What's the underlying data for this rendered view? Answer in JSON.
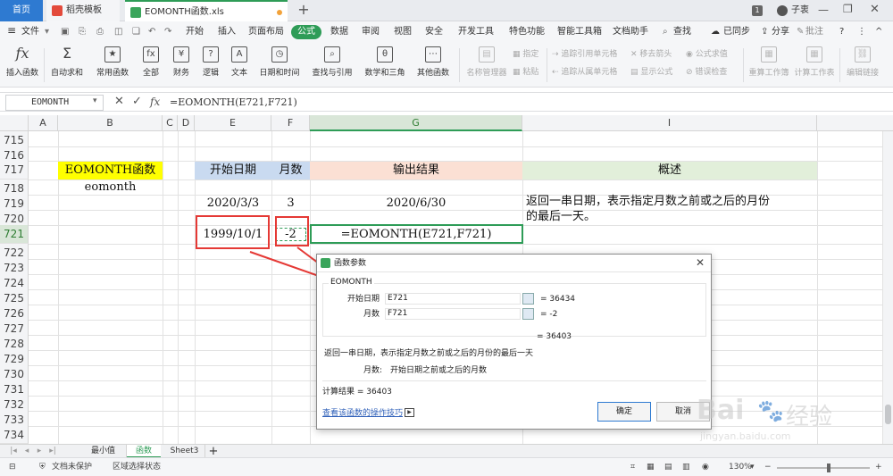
{
  "tabs": {
    "home": "首页",
    "templates": "稻壳模板",
    "file": "EOMONTH函数.xls",
    "add": "+"
  },
  "window": {
    "badge": "1",
    "user": "子衷"
  },
  "menu": {
    "file": "文件",
    "items": [
      "开始",
      "插入",
      "页面布局",
      "公式",
      "数据",
      "审阅",
      "视图",
      "安全",
      "开发工具",
      "特色功能",
      "智能工具箱",
      "文档助手"
    ],
    "search": "查找",
    "sync": "已同步",
    "share": "分享",
    "comment": "批注"
  },
  "ribbon": {
    "insert_function": "插入函数",
    "autosum": "自动求和",
    "common": "常用函数",
    "all": "全部",
    "finance": "财务",
    "logic": "逻辑",
    "text": "文本",
    "datetime": "日期和时间",
    "lookup": "查找与引用",
    "math": "数学和三角",
    "other": "其他函数",
    "name_manager": "名称管理器",
    "specify": "指定",
    "paste": "粘贴",
    "trace_precedents": "追踪引用单元格",
    "trace_dependents": "追踪从属单元格",
    "remove_arrows": "移去箭头",
    "show_formulas": "显示公式",
    "evaluate": "公式求值",
    "error_check": "错误检查",
    "recalc_workbook": "重算工作簿",
    "calc_sheet": "计算工作表",
    "edit_links": "编辑链接"
  },
  "formula_bar": {
    "name_box": "EOMONTH",
    "fx": "fx",
    "formula": "=EOMONTH(E721,F721)"
  },
  "columns": [
    "A",
    "B",
    "C",
    "D",
    "E",
    "F",
    "G",
    "I"
  ],
  "rows": [
    "715",
    "716",
    "717",
    "718",
    "719",
    "720",
    "721",
    "722",
    "723",
    "724",
    "725",
    "726",
    "727",
    "728",
    "729",
    "730",
    "731",
    "732",
    "733",
    "734"
  ],
  "cells": {
    "b717": "EOMONTH函数",
    "b718": "eomonth",
    "e717": "开始日期",
    "f717": "月数",
    "g717": "输出结果",
    "i717": "概述",
    "e719": "2020/3/3",
    "f719": "3",
    "g719": "2020/6/30",
    "i719a": "返回一串日期，表示指定月数之前或之后的月份",
    "i719b": "的最后一天。",
    "e721": "1999/10/1",
    "f721": "-2",
    "g721": "=EOMONTH(E721,F721)"
  },
  "dialog": {
    "title": "函数参数",
    "func": "EOMONTH",
    "arg1_label": "开始日期",
    "arg1_value": "E721",
    "arg1_result": "= 36434",
    "arg2_label": "月数",
    "arg2_value": "F721",
    "arg2_result": "= -2",
    "result_line": "= 36403",
    "description": "返回一串日期，表示指定月数之前或之后的月份的最后一天",
    "arg_help_label": "月数:",
    "arg_help": "开始日期之前或之后的月数",
    "calc_result": "计算结果 = 36403",
    "help_link": "查看该函数的操作技巧",
    "ok": "确定",
    "cancel": "取消"
  },
  "sheets": [
    "最小值",
    "函数",
    "Sheet3"
  ],
  "status": {
    "protect": "文档未保护",
    "selection": "区域选择状态",
    "zoom": "130%"
  },
  "watermark": {
    "brand": "Bai",
    "brand2": "经验",
    "url": "jingyan.baidu.com"
  },
  "colors": {
    "green": "#2e9c57",
    "yellow": "#ffff00",
    "blue_header": "#c9daf0",
    "peach": "#fbe0d4",
    "green_header": "#e2efda",
    "red": "#e53935"
  }
}
